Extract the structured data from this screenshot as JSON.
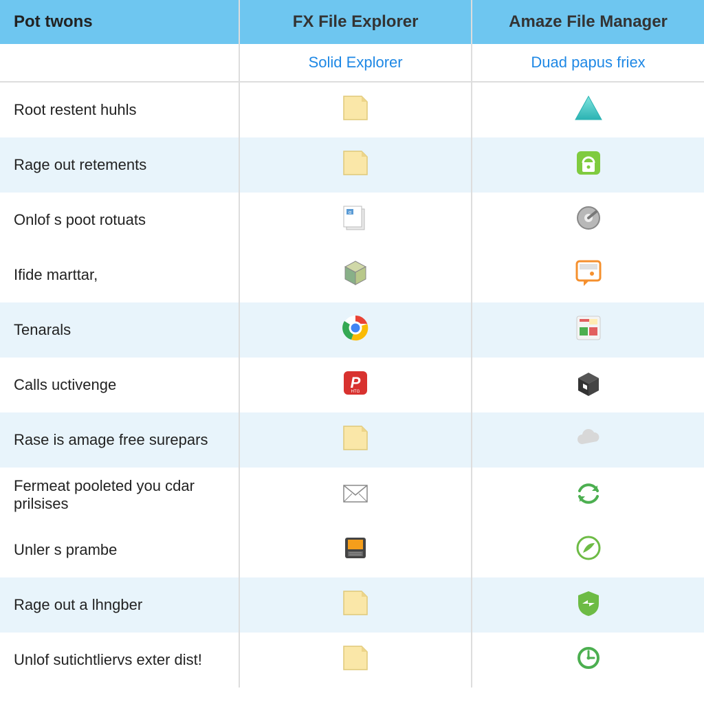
{
  "header": {
    "col0": "Pot twons",
    "col1": "FX File Explorer",
    "col2": "Amaze File Manager"
  },
  "sub": {
    "col1": "Solid Explorer",
    "col2": "Duad papus friex"
  },
  "rows": [
    {
      "label": "Root restent huhls",
      "iconA": "folder-icon",
      "iconB": "triangle-icon",
      "stripe": false
    },
    {
      "label": "Rage out retements",
      "iconA": "folder-icon",
      "iconB": "lock-icon",
      "stripe": true
    },
    {
      "label": "Onlof s poot rotuats",
      "iconA": "docs-icon",
      "iconB": "dial-icon",
      "stripe": false
    },
    {
      "label": "Ifide marttar,",
      "iconA": "cube-icon",
      "iconB": "speech-icon",
      "stripe": false
    },
    {
      "label": "Tenarals",
      "iconA": "chrome-icon",
      "iconB": "media-icon",
      "stripe": true
    },
    {
      "label": "Calls uctivenge",
      "iconA": "p-icon",
      "iconB": "box-icon",
      "stripe": false
    },
    {
      "label": "Rase is amage free surepars",
      "iconA": "folder-icon",
      "iconB": "cloud-icon",
      "stripe": true
    },
    {
      "label": "Fermeat pooleted you cdar prilsises",
      "iconA": "envelope-icon",
      "iconB": "sync-icon",
      "stripe": false
    },
    {
      "label": "Unler s prambe",
      "iconA": "device-icon",
      "iconB": "leaf-icon",
      "stripe": false
    },
    {
      "label": "Rage out a lhngber",
      "iconA": "folder-icon",
      "iconB": "shield-icon",
      "stripe": true
    },
    {
      "label": "Unlof sutichtliervs exter dist!",
      "iconA": "folder-icon",
      "iconB": "clock-icon",
      "stripe": false
    }
  ],
  "colors": {
    "headerBg": "#6EC6F0",
    "link": "#1E88E5",
    "stripe": "#E8F4FB"
  }
}
